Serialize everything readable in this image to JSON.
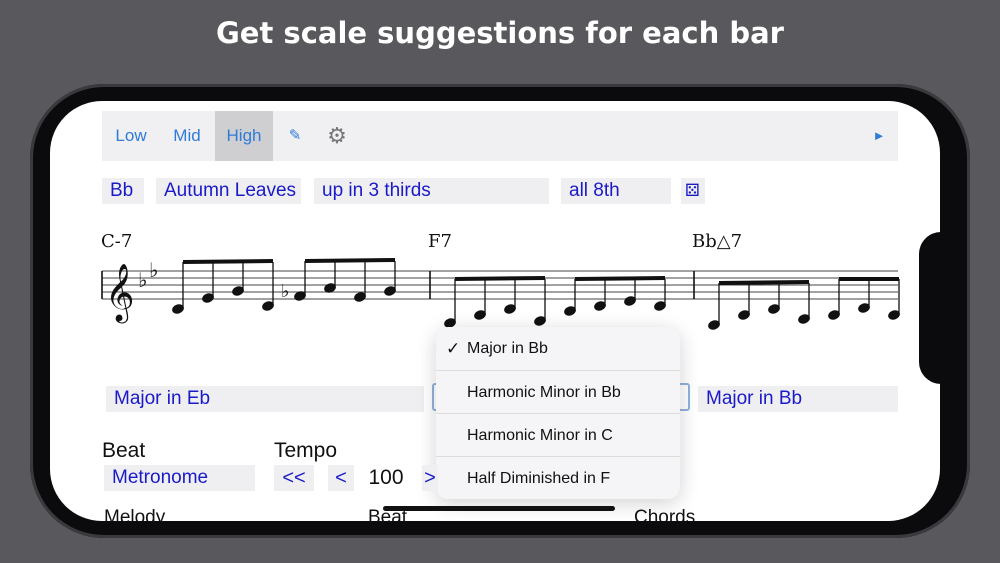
{
  "headline": "Get scale suggestions for each bar",
  "toolbar": {
    "low": "Low",
    "mid": "Mid",
    "high": "High",
    "pencil_icon": "✎",
    "settings_icon": "⚙",
    "play_icon": "►"
  },
  "selectors": {
    "key": "Bb",
    "tune": "Autumn Leaves",
    "pattern": "up in 3 thirds",
    "rhythm": "all 8th",
    "dice_icon": "⚄"
  },
  "chords": [
    "C-7",
    "F7",
    "Bb△7"
  ],
  "scales": {
    "bar1": "Major in Eb",
    "bar3": "Major in Bb"
  },
  "dropdown": {
    "items": [
      {
        "label": "Major in Bb",
        "checked": true
      },
      {
        "label": "Harmonic Minor in Bb",
        "checked": false
      },
      {
        "label": "Harmonic Minor in C",
        "checked": false
      },
      {
        "label": "Half Diminished in F",
        "checked": false
      }
    ],
    "check_mark": "✓"
  },
  "beat": {
    "label": "Beat",
    "value": "Metronome"
  },
  "tempo": {
    "label": "Tempo",
    "rewind": "<<",
    "down": "<",
    "value": "100",
    "up": ">"
  },
  "bottom_labels": {
    "melody": "Melody",
    "beat": "Beat",
    "chords": "Chords"
  }
}
